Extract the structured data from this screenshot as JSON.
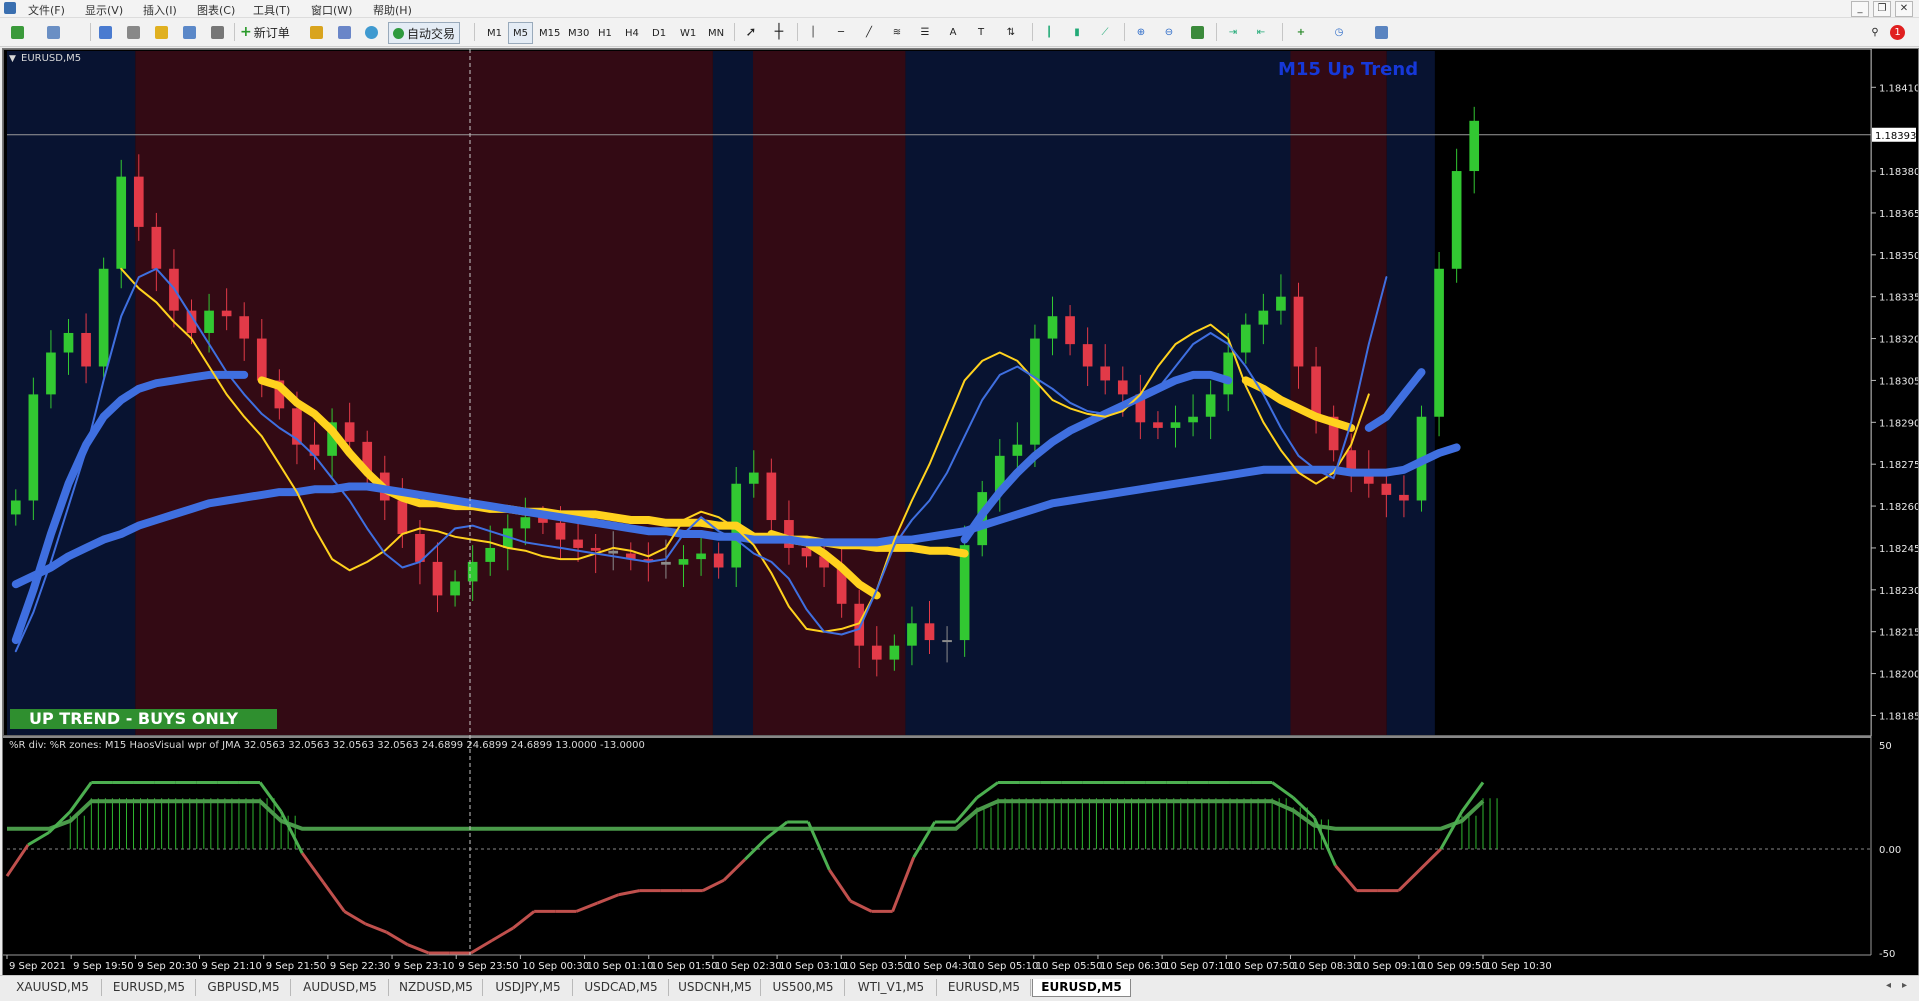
{
  "menu": [
    "文件(F)",
    "显示(V)",
    "插入(I)",
    "图表(C)",
    "工具(T)",
    "窗口(W)",
    "帮助(H)"
  ],
  "window_controls": [
    "_",
    "❐",
    "✕"
  ],
  "toolbar": {
    "new_order_label": "新订单",
    "auto_trade_label": "自动交易",
    "timeframes": [
      "M1",
      "M5",
      "M15",
      "M30",
      "H1",
      "H4",
      "D1",
      "W1",
      "MN"
    ],
    "active_timeframe": "M5",
    "text_tool": "A",
    "label_tool": "T",
    "notification_count": "1"
  },
  "chart": {
    "symbol_label": "EURUSD,M5",
    "trend_label": "M15 Up Trend",
    "signal_banner": "UP TREND - BUYS ONLY",
    "current_price": "1.18393",
    "price_axis_labels": [
      "1.18410",
      "1.18380",
      "1.18365",
      "1.18350",
      "1.18335",
      "1.18320",
      "1.18305",
      "1.18290",
      "1.18275",
      "1.18260",
      "1.18245",
      "1.18230",
      "1.18215",
      "1.18200",
      "1.18185"
    ],
    "indicator_caption": "%R div: %R zones: M15 HaosVisual wpr of JMA 32.0563 32.0563 32.0563 32.0563 24.6899 24.6899 24.6899 13.0000 -13.0000",
    "indicator_axis_labels": [
      "50",
      "0.00",
      "-50"
    ],
    "time_labels": [
      "9 Sep 2021",
      "9 Sep 19:50",
      "9 Sep 20:30",
      "9 Sep 21:10",
      "9 Sep 21:50",
      "9 Sep 22:30",
      "9 Sep 23:10",
      "9 Sep 23:50",
      "10 Sep 00:30",
      "10 Sep 01:10",
      "10 Sep 01:50",
      "10 Sep 02:30",
      "10 Sep 03:10",
      "10 Sep 03:50",
      "10 Sep 04:30",
      "10 Sep 05:10",
      "10 Sep 05:50",
      "10 Sep 06:30",
      "10 Sep 07:10",
      "10 Sep 07:50",
      "10 Sep 08:30",
      "10 Sep 09:10",
      "10 Sep 09:50",
      "10 Sep 10:30"
    ],
    "colors": {
      "up_zone": "#081331",
      "down_zone": "#330a14",
      "bull_candle": "#32c832",
      "bear_candle": "#e23a48",
      "neutral_candle": "#8c8c8c",
      "slow_ma": "#3f6fe0",
      "fast_ma": "#ffd21e",
      "banner": "#2f8f2f",
      "trend_text": "#1638d8"
    }
  },
  "chart_data": {
    "type": "line",
    "symbol": "EURUSD",
    "timeframe": "M5",
    "title": "EURUSD,M5",
    "subtitle": "M15 Up Trend",
    "ylim": [
      1.18178,
      1.18423
    ],
    "y_ticks": [
      1.1841,
      1.1838,
      1.18365,
      1.1835,
      1.18335,
      1.1832,
      1.18305,
      1.1829,
      1.18275,
      1.1826,
      1.18245,
      1.1823,
      1.18215,
      1.182,
      1.18185
    ],
    "x_ticks": [
      "9 Sep 2021",
      "9 Sep 19:50",
      "9 Sep 20:30",
      "9 Sep 21:10",
      "9 Sep 21:50",
      "9 Sep 22:30",
      "9 Sep 23:10",
      "9 Sep 23:50",
      "10 Sep 00:30",
      "10 Sep 01:10",
      "10 Sep 01:50",
      "10 Sep 02:30",
      "10 Sep 03:10",
      "10 Sep 03:50",
      "10 Sep 04:30",
      "10 Sep 05:10",
      "10 Sep 05:50",
      "10 Sep 06:30",
      "10 Sep 07:10",
      "10 Sep 07:50",
      "10 Sep 08:30",
      "10 Sep 09:10",
      "10 Sep 09:50",
      "10 Sep 10:30"
    ],
    "zones": [
      {
        "from": "9 Sep 2021",
        "to": "9 Sep 20:30",
        "state": "up"
      },
      {
        "from": "9 Sep 20:30",
        "to": "10 Sep 02:30",
        "state": "down"
      },
      {
        "from": "10 Sep 02:30",
        "to": "10 Sep 02:55",
        "state": "up"
      },
      {
        "from": "10 Sep 02:55",
        "to": "10 Sep 04:30",
        "state": "down"
      },
      {
        "from": "10 Sep 04:30",
        "to": "10 Sep 08:30",
        "state": "up"
      },
      {
        "from": "10 Sep 08:30",
        "to": "10 Sep 09:30",
        "state": "down"
      },
      {
        "from": "10 Sep 09:30",
        "to": "10 Sep 10:00",
        "state": "up"
      }
    ],
    "close": [
      1.18262,
      1.183,
      1.18315,
      1.18322,
      1.1831,
      1.18345,
      1.18378,
      1.1836,
      1.18345,
      1.1833,
      1.18322,
      1.1833,
      1.18328,
      1.1832,
      1.18305,
      1.18295,
      1.18282,
      1.18278,
      1.1829,
      1.18283,
      1.18272,
      1.18262,
      1.1825,
      1.1824,
      1.18228,
      1.18233,
      1.1824,
      1.18245,
      1.18252,
      1.18256,
      1.18254,
      1.18248,
      1.18245,
      1.18244,
      1.18243,
      1.18241,
      1.1824,
      1.18239,
      1.18241,
      1.18243,
      1.18238,
      1.18268,
      1.18272,
      1.18255,
      1.18245,
      1.18242,
      1.18238,
      1.18225,
      1.1821,
      1.18205,
      1.1821,
      1.18218,
      1.18212,
      1.18212,
      1.18246,
      1.18265,
      1.18278,
      1.18282,
      1.1832,
      1.18328,
      1.18318,
      1.1831,
      1.18305,
      1.183,
      1.1829,
      1.18288,
      1.1829,
      1.18292,
      1.183,
      1.18315,
      1.18325,
      1.1833,
      1.18335,
      1.1831,
      1.18292,
      1.1828,
      1.18272,
      1.18268,
      1.18264,
      1.18262,
      1.18292,
      1.18345,
      1.1838,
      1.18398
    ],
    "series": [
      {
        "name": "",
        "style": "thick",
        "color": "#ffd21e",
        "values": [
          null,
          null,
          null,
          null,
          null,
          null,
          null,
          null,
          null,
          null,
          null,
          null,
          null,
          null,
          1.18305,
          1.18303,
          1.18297,
          1.18293,
          1.18287,
          1.18279,
          1.18272,
          1.18266,
          1.18263,
          1.18261,
          1.18261,
          1.1826,
          1.1826,
          1.18259,
          1.18259,
          1.18258,
          1.18258,
          1.18257,
          1.18257,
          1.18257,
          1.18256,
          1.18255,
          1.18255,
          1.18254,
          1.18254,
          1.18254,
          1.18253,
          1.18253,
          1.18249,
          1.18249,
          1.18248,
          1.18248,
          1.18247,
          1.18246,
          1.18246,
          1.18245,
          1.18245,
          1.18245,
          1.18244,
          1.18244,
          1.18243,
          null,
          null,
          null,
          null,
          null,
          null,
          null,
          null,
          null,
          null,
          null,
          null,
          null,
          null,
          null,
          1.18305,
          1.18302,
          1.18298,
          1.18295,
          1.18292,
          1.1829,
          1.18288
        ]
      },
      {
        "name": "",
        "style": "thick",
        "color": "#ffd21e",
        "values": [
          null,
          null,
          null,
          null,
          null,
          null,
          null,
          null,
          null,
          null,
          null,
          null,
          null,
          null,
          null,
          null,
          null,
          null,
          null,
          null,
          null,
          null,
          null,
          null,
          null,
          null,
          null,
          null,
          null,
          null,
          null,
          null,
          null,
          null,
          null,
          null,
          null,
          null,
          null,
          null,
          null,
          null,
          null,
          1.1825,
          1.18248,
          1.18247,
          1.18243,
          1.18238,
          1.18232,
          1.18228
        ]
      },
      {
        "name": "",
        "style": "thick",
        "color": "#3f6fe0",
        "values": [
          1.18232,
          1.18235,
          1.18238,
          1.18242,
          1.18245,
          1.18248,
          1.1825,
          1.18253,
          1.18255,
          1.18257,
          1.18259,
          1.18261,
          1.18262,
          1.18263,
          1.18264,
          1.18265,
          1.18265,
          1.18266,
          1.18266,
          1.18267,
          1.18267,
          1.18266,
          1.18265,
          1.18264,
          1.18263,
          1.18262,
          1.18261,
          1.1826,
          1.18259,
          1.18258,
          1.18257,
          1.18256,
          1.18255,
          1.18254,
          1.18253,
          1.18252,
          1.18251,
          1.18251,
          1.1825,
          1.1825,
          1.18249,
          1.18249,
          1.18248,
          1.18248,
          1.18248,
          1.18247,
          1.18247,
          1.18247,
          1.18247,
          1.18247,
          1.18248,
          1.18248,
          1.18249,
          1.1825,
          1.18251,
          1.18253,
          1.18255,
          1.18257,
          1.18259,
          1.18261,
          1.18262,
          1.18263,
          1.18264,
          1.18265,
          1.18266,
          1.18267,
          1.18268,
          1.18269,
          1.1827,
          1.18271,
          1.18272,
          1.18273,
          1.18273,
          1.18273,
          1.18273,
          1.18273,
          1.18272,
          1.18272,
          1.18272,
          1.18273,
          1.18276,
          1.18279,
          1.18281
        ]
      },
      {
        "name": "",
        "style": "thick",
        "color": "#3f6fe0",
        "values": [
          1.18212,
          1.1823,
          1.1825,
          1.18268,
          1.18282,
          1.18292,
          1.18298,
          1.18302,
          1.18304,
          1.18305,
          1.18306,
          1.18307,
          1.18307,
          1.18307,
          null,
          null,
          null,
          null,
          null,
          null,
          null,
          null,
          null,
          null,
          null,
          null,
          null,
          null,
          null,
          null,
          null,
          null,
          null,
          null,
          null,
          null,
          null,
          null,
          null,
          null,
          null,
          null,
          null,
          null,
          null,
          null,
          null,
          null,
          null,
          null,
          null,
          null,
          null,
          null,
          1.18248,
          1.18257,
          1.18265,
          1.18272,
          1.18278,
          1.18283,
          1.18287,
          1.1829,
          1.18293,
          1.18296,
          1.18299,
          1.18302,
          1.18305,
          1.18307,
          1.18307,
          1.18305,
          null,
          null,
          null,
          null,
          null,
          null,
          null,
          1.18288,
          1.18292,
          1.183,
          1.18308
        ]
      },
      {
        "name": "",
        "style": "thin",
        "color": "#ffd21e",
        "values": [
          null,
          null,
          null,
          null,
          null,
          null,
          1.18345,
          1.18338,
          1.18333,
          1.18326,
          1.1832,
          1.1831,
          1.183,
          1.18292,
          1.18285,
          1.18275,
          1.18265,
          1.18252,
          1.18241,
          1.18237,
          1.1824,
          1.18244,
          1.1825,
          1.18252,
          1.18251,
          1.18249,
          1.18248,
          1.18247,
          1.18245,
          1.18244,
          1.18242,
          1.18241,
          1.18241,
          1.18243,
          1.18245,
          1.18244,
          1.18242,
          1.18245,
          1.18255,
          1.18258,
          1.18256,
          1.18252,
          1.18246,
          1.18236,
          1.18224,
          1.18216,
          1.18215,
          1.18216,
          1.18218,
          1.1823,
          1.18248,
          1.18262,
          1.18275,
          1.1829,
          1.18305,
          1.18312,
          1.18315,
          1.18312,
          1.18305,
          1.18298,
          1.18295,
          1.18293,
          1.18292,
          1.18294,
          1.183,
          1.1831,
          1.18318,
          1.18322,
          1.18325,
          1.1832,
          1.18303,
          1.1829,
          1.1828,
          1.18272,
          1.18268,
          1.18272,
          1.18282,
          1.183
        ]
      },
      {
        "name": "",
        "style": "thin",
        "color": "#3f6fe0",
        "values": [
          1.18208,
          1.18222,
          1.1824,
          1.1826,
          1.1828,
          1.18305,
          1.18328,
          1.18342,
          1.18345,
          1.18338,
          1.18328,
          1.18318,
          1.18308,
          1.183,
          1.18293,
          1.18288,
          1.18284,
          1.18278,
          1.1827,
          1.18262,
          1.18252,
          1.18243,
          1.18238,
          1.1824,
          1.18246,
          1.18252,
          1.18253,
          1.18251,
          1.18249,
          1.18247,
          1.18246,
          1.18245,
          1.18244,
          1.18243,
          1.18242,
          1.18241,
          1.1824,
          1.18241,
          1.1825,
          1.18256,
          1.18251,
          1.18248,
          1.18243,
          1.1824,
          1.18234,
          1.18223,
          1.18215,
          1.18214,
          1.18216,
          1.1823,
          1.18246,
          1.18255,
          1.18262,
          1.18272,
          1.18285,
          1.18298,
          1.18307,
          1.1831,
          1.18306,
          1.18302,
          1.18297,
          1.18294,
          1.18293,
          1.18295,
          1.18298,
          1.18302,
          1.1831,
          1.18318,
          1.18322,
          1.18318,
          1.1831,
          1.183,
          1.18288,
          1.18278,
          1.18273,
          1.1827,
          1.1829,
          1.18318,
          1.18342
        ]
      }
    ],
    "indicator": {
      "caption": "%R div: %R zones: M15 HaosVisual wpr of JMA 32.0563 32.0563 32.0563 32.0563 24.6899 24.6899 24.6899 13.0000 -13.0000",
      "ylim": [
        -50,
        50
      ],
      "levels": [
        13.0,
        -13.0
      ],
      "wpr_values": [
        -13,
        2,
        8,
        18,
        32,
        32,
        32,
        32,
        32,
        32,
        32,
        32,
        32,
        18,
        -2,
        -16,
        -30,
        -36,
        -40,
        -46,
        -50,
        -50,
        -50,
        -44,
        -38,
        -30,
        -30,
        -30,
        -26,
        -22,
        -20,
        -20,
        -20,
        -20,
        -15,
        -5,
        5,
        13,
        13,
        -10,
        -25,
        -30,
        -30,
        -4,
        13,
        13,
        24.69,
        32,
        32,
        32,
        32,
        32,
        32,
        32,
        32,
        32,
        32,
        32,
        32,
        32,
        32,
        24.69,
        15,
        -8,
        -20,
        -20,
        -20,
        -10,
        0,
        18,
        32
      ]
    }
  },
  "tabs": [
    {
      "label": "XAUUSD,M5",
      "active": false
    },
    {
      "label": "EURUSD,M5",
      "active": false
    },
    {
      "label": "GBPUSD,M5",
      "active": false
    },
    {
      "label": "AUDUSD,M5",
      "active": false
    },
    {
      "label": "NZDUSD,M5",
      "active": false
    },
    {
      "label": "USDJPY,M5",
      "active": false
    },
    {
      "label": "USDCAD,M5",
      "active": false
    },
    {
      "label": "USDCNH,M5",
      "active": false
    },
    {
      "label": "US500,M5",
      "active": false
    },
    {
      "label": "WTI_V1,M5",
      "active": false
    },
    {
      "label": "EURUSD,M5",
      "active": false
    },
    {
      "label": "EURUSD,M5",
      "active": true
    }
  ]
}
